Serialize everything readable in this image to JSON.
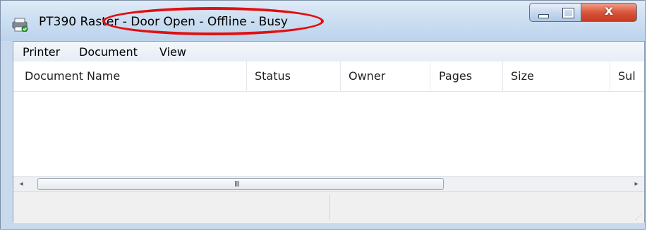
{
  "window": {
    "title": "PT390 Raster - Door Open - Offline - Busy",
    "controls": {
      "minimize": "",
      "maximize": "",
      "close": "x"
    },
    "highlight_color": "#e01010"
  },
  "menu": {
    "items": [
      "Printer",
      "Document",
      "View"
    ]
  },
  "columns": [
    "Document Name",
    "Status",
    "Owner",
    "Pages",
    "Size",
    "Sul"
  ],
  "scrollbar": {
    "grip": "III",
    "left_arrow": "◂",
    "right_arrow": "▸"
  },
  "statusbar": {
    "left": "",
    "right": ""
  },
  "colors": {
    "close_button": "#d9553b",
    "title_bar": "#cddff2"
  }
}
